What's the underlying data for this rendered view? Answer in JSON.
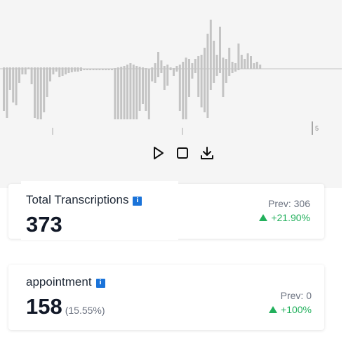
{
  "waveform": {
    "tick_label": "5",
    "bar_color": "#c4c4c4",
    "heights_up": [
      0,
      0,
      0,
      0,
      0,
      0,
      0,
      0,
      0,
      0,
      0,
      0,
      0,
      0,
      0,
      0,
      0,
      0,
      0,
      0,
      0,
      0,
      0,
      0,
      0,
      0,
      0,
      0,
      0,
      0,
      0,
      0,
      0,
      0,
      0,
      0,
      0,
      0,
      0,
      0,
      0,
      0,
      0,
      0,
      0,
      0,
      0,
      0,
      0,
      0,
      0,
      0,
      0,
      0,
      0,
      0,
      0,
      0,
      0,
      0,
      0,
      1,
      2,
      4,
      6,
      7,
      5,
      3,
      2,
      1,
      0,
      0,
      0,
      0,
      0,
      0,
      0,
      0,
      0,
      0,
      0,
      0,
      0,
      0,
      0,
      0,
      0,
      0,
      0,
      0,
      0,
      0,
      0,
      0,
      0,
      0,
      0,
      0,
      0,
      0,
      0,
      0,
      0,
      0,
      0,
      0,
      0,
      0,
      0,
      0,
      0,
      0,
      0,
      0,
      0,
      0,
      0,
      0,
      0,
      0,
      0
    ],
    "heights_down": [
      5,
      55,
      62,
      30,
      48,
      52,
      20,
      8,
      8,
      0,
      22,
      70,
      72,
      72,
      62,
      40,
      18,
      8,
      0,
      0,
      0,
      0,
      0,
      0,
      0,
      0,
      0,
      0,
      0,
      0,
      0,
      0,
      0,
      0,
      0,
      0,
      62,
      62,
      70,
      72,
      76,
      52,
      50,
      60,
      72,
      18,
      20,
      12,
      0,
      30,
      24,
      2,
      10,
      0,
      0,
      4,
      60,
      72,
      72,
      40,
      0,
      0,
      0,
      6,
      40,
      55,
      62,
      70,
      0,
      0,
      0,
      0,
      0,
      0,
      0,
      0,
      0,
      0
    ],
    "peaks_up": [
      0,
      0,
      0,
      0,
      0,
      0,
      0,
      0,
      0,
      0,
      0,
      0,
      0,
      0,
      0,
      0,
      0,
      0,
      0,
      0,
      0,
      0,
      0,
      0,
      0,
      0,
      0,
      0,
      0,
      0,
      0,
      0,
      0,
      0,
      0,
      0,
      0,
      0,
      0,
      0,
      0,
      0,
      0,
      0,
      0,
      0,
      0,
      0,
      0,
      0,
      0,
      0,
      0,
      0,
      0,
      0,
      0,
      0,
      0,
      0,
      0,
      0,
      0,
      0,
      0,
      0,
      0,
      0,
      0,
      0,
      0,
      0,
      0,
      0,
      0,
      0,
      0,
      0
    ]
  },
  "controls": {
    "play_icon": "play-icon",
    "stop_icon": "stop-icon",
    "download_icon": "download-icon"
  },
  "cards": [
    {
      "title": "Total Transcriptions",
      "info": "i",
      "value": "373",
      "percentage": "",
      "prev": "Prev: 306",
      "change": "+21.90%",
      "change_color": "#22b05c"
    },
    {
      "title": "appointment",
      "info": "i",
      "value": "158",
      "percentage": "(15.55%)",
      "prev": "Prev: 0",
      "change": "+100%",
      "change_color": "#22b05c"
    }
  ],
  "colors": {
    "info_badge": "#1a73d9",
    "positive": "#22b05c",
    "panel_bg": "#f5f5f5"
  }
}
